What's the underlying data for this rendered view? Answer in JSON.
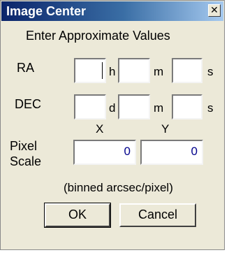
{
  "dialog": {
    "title": "Image Center",
    "close_glyph": "✕",
    "instruction": "Enter Approximate Values"
  },
  "ra": {
    "label": "RA",
    "hours_value": "",
    "hours_unit": "h",
    "minutes_value": "",
    "minutes_unit": "m",
    "seconds_value": "",
    "seconds_unit": "s"
  },
  "dec": {
    "label": "DEC",
    "degrees_value": "",
    "degrees_unit": "d",
    "minutes_value": "",
    "minutes_unit": "m",
    "seconds_value": "",
    "seconds_unit": "s"
  },
  "pixel_scale": {
    "label_line1": "Pixel",
    "label_line2": "Scale",
    "x_header": "X",
    "y_header": "Y",
    "x_value": "0",
    "y_value": "0",
    "units": "(binned arcsec/pixel)"
  },
  "buttons": {
    "ok": "OK",
    "cancel": "Cancel"
  }
}
